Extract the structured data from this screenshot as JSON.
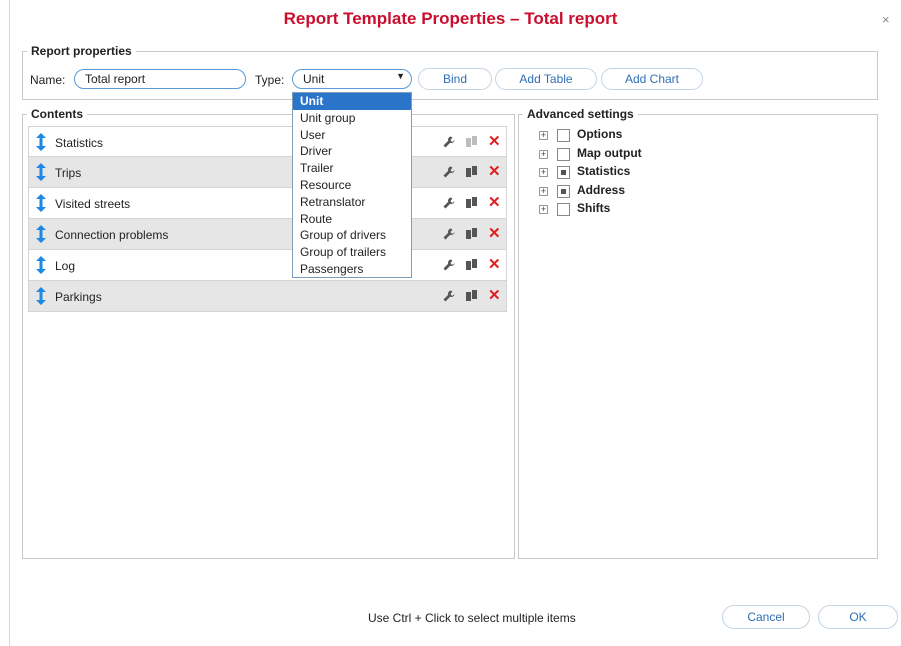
{
  "dialog": {
    "title": "Report Template Properties – Total report",
    "close_symbol": "×"
  },
  "report_properties": {
    "legend": "Report properties",
    "name_label": "Name:",
    "name_value": "Total report",
    "type_label": "Type:",
    "type_value": "Unit",
    "buttons": {
      "bind": "Bind",
      "add_table": "Add Table",
      "add_chart": "Add Chart"
    }
  },
  "type_dropdown": {
    "selected": "Unit",
    "options": [
      "Unit",
      "Unit group",
      "User",
      "Driver",
      "Trailer",
      "Resource",
      "Retranslator",
      "Route",
      "Group of drivers",
      "Group of trailers",
      "Passengers"
    ]
  },
  "contents": {
    "legend": "Contents",
    "rows": [
      {
        "label": "Statistics",
        "copy_enabled": false
      },
      {
        "label": "Trips",
        "copy_enabled": true
      },
      {
        "label": "Visited streets",
        "copy_enabled": true
      },
      {
        "label": "Connection problems",
        "copy_enabled": true
      },
      {
        "label": "Log",
        "copy_enabled": true
      },
      {
        "label": "Parkings",
        "copy_enabled": true
      }
    ],
    "delete_symbol": "✕"
  },
  "advanced": {
    "legend": "Advanced settings",
    "nodes": [
      {
        "label": "Options",
        "state": "unchecked"
      },
      {
        "label": "Map output",
        "state": "unchecked"
      },
      {
        "label": "Statistics",
        "state": "partial"
      },
      {
        "label": "Address",
        "state": "partial"
      },
      {
        "label": "Shifts",
        "state": "unchecked"
      }
    ],
    "expand_symbol": "+"
  },
  "footer": {
    "hint": "Use Ctrl + Click to select multiple items",
    "cancel": "Cancel",
    "ok": "OK"
  },
  "colors": {
    "title": "#c8102e",
    "accent": "#2f6fb3",
    "selected": "#2a74c9",
    "drag_arrow": "#1e88e5",
    "delete": "#e02020",
    "row_alt": "#e6e6e6"
  },
  "icons": {
    "drag": "vertical-arrow-icon",
    "settings": "wrench-icon",
    "copy": "copy-icon",
    "delete": "close-x-icon",
    "expand": "plus-box-icon"
  }
}
